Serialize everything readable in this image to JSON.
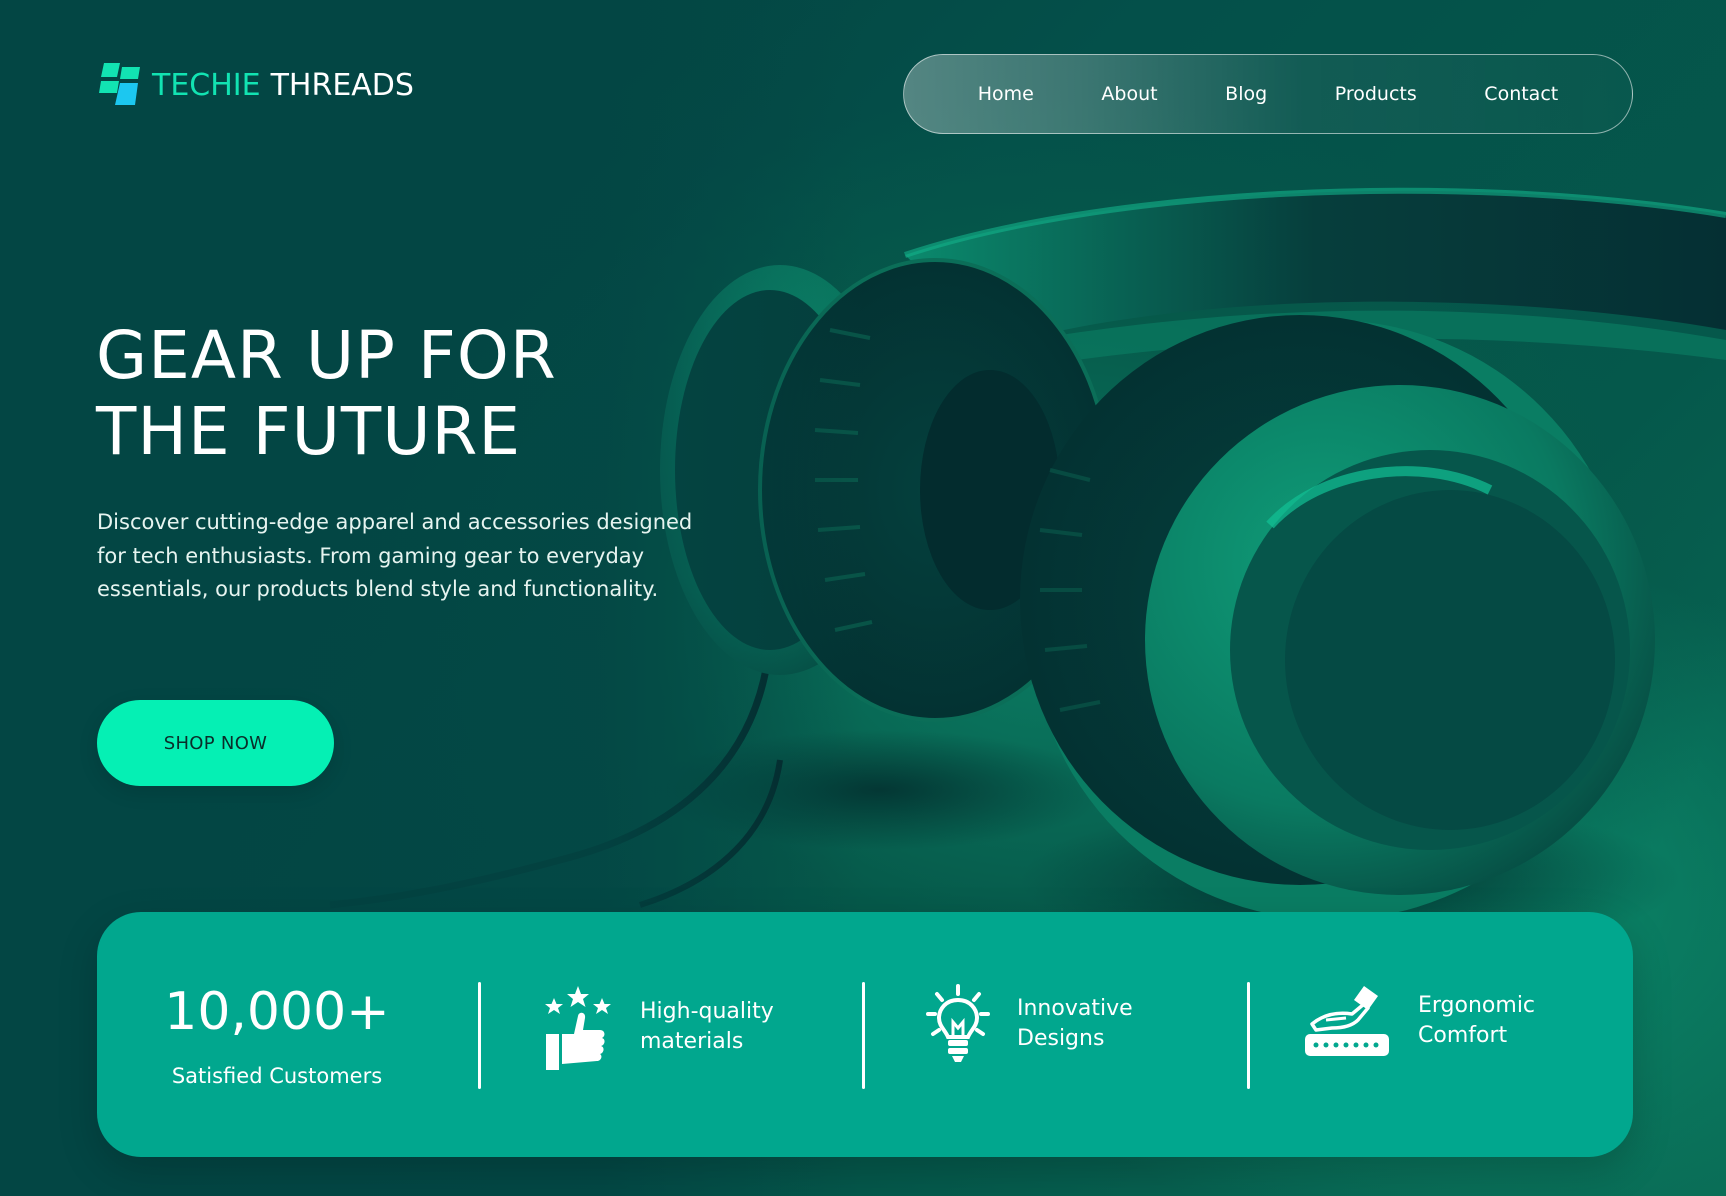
{
  "brand": {
    "name_part1": "TECHIE",
    "name_part2": "THREADS",
    "logo_icon": "stacked-tiles-logo-icon"
  },
  "nav": {
    "items": [
      {
        "label": "Home"
      },
      {
        "label": "About"
      },
      {
        "label": "Blog"
      },
      {
        "label": "Products"
      },
      {
        "label": "Contact"
      }
    ]
  },
  "hero": {
    "title_line1": "GEAR UP FOR",
    "title_line2": "THE FUTURE",
    "description": "Discover cutting-edge apparel and accessories designed for tech enthusiasts. From gaming gear to everyday essentials, our products blend style and functionality.",
    "cta_label": "SHOP NOW",
    "image": "headphones-photo"
  },
  "stats": {
    "customers_count": "10,000+",
    "customers_label": "Satisfied Customers",
    "features": [
      {
        "icon": "thumbs-up-stars-icon",
        "line1": "High-quality",
        "line2": "materials"
      },
      {
        "icon": "lightbulb-icon",
        "line1": "Innovative",
        "line2": "Designs"
      },
      {
        "icon": "hand-cushion-icon",
        "line1": "Ergonomic",
        "line2": "Comfort"
      }
    ]
  },
  "colors": {
    "accent": "#05f0b4",
    "brand_teal": "#12e3b2",
    "stats_band": "#01a78e",
    "background": "#04504a"
  }
}
